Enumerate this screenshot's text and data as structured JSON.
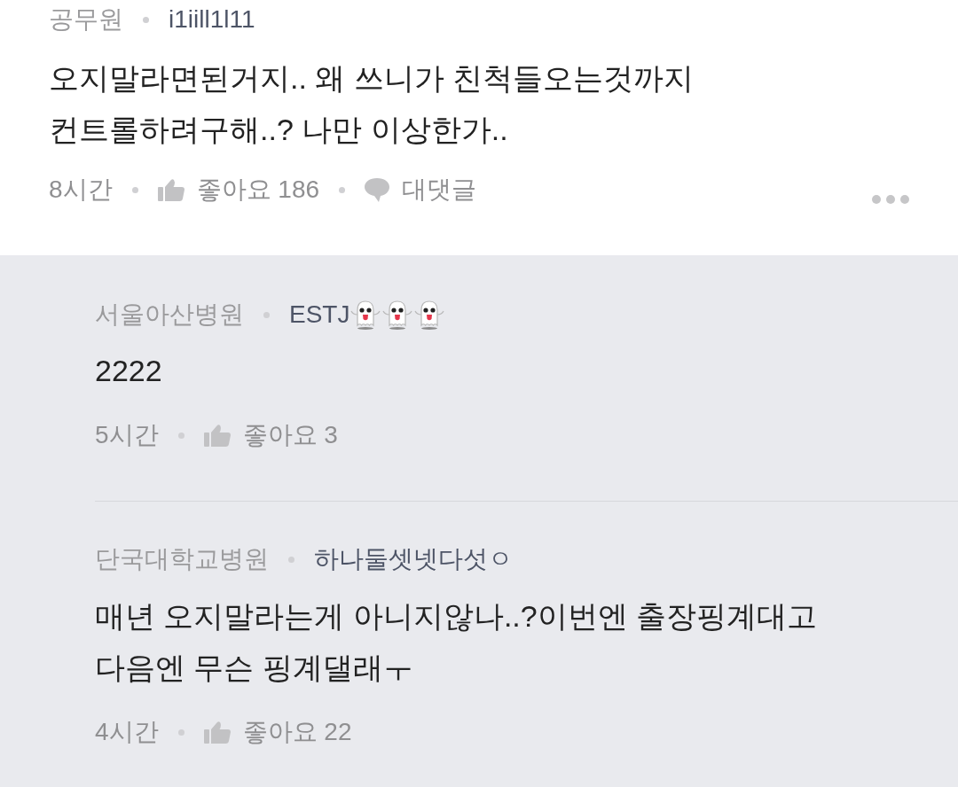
{
  "comment": {
    "workplace": "공무원",
    "nickname": "i1iill1l11",
    "text_lines": [
      "오지말라면된거지.. 왜 쓰니가 친척들오는것까지",
      "컨트롤하려구해..? 나만 이상한가.."
    ],
    "time": "8시간",
    "likes": "좋아요 186",
    "reply_button": "대댓글",
    "more_menu": true
  },
  "replies": [
    {
      "workplace": "서울아산병원",
      "nickname": "ESTJ",
      "nickname_emoji": [
        {
          "kind": "ghost"
        },
        {
          "kind": "ghost"
        },
        {
          "kind": "ghost"
        }
      ],
      "text_lines": [
        "2222"
      ],
      "time": "5시간",
      "likes": "좋아요 3"
    },
    {
      "workplace": "단국대학교병원",
      "nickname": "하나둘셋넷다섯ㅇ",
      "text_lines": [
        "매년 오지말라는게 아니지않나..?이번엔 출장핑계대고",
        "다음엔 무슨 핑계댈래ㅜ"
      ],
      "time": "4시간",
      "likes": "좋아요 22"
    }
  ]
}
